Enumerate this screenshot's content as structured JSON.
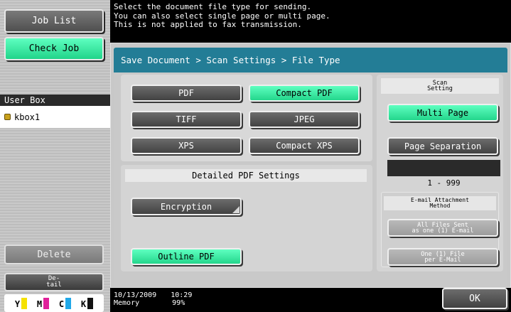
{
  "sidebar": {
    "job_list": "Job List",
    "check_job": "Check Job",
    "user_box_title": "User Box",
    "user_box_item": "kbox1",
    "delete": "Delete",
    "detail_line1": "De-",
    "detail_line2": "tail",
    "toner": [
      {
        "letter": "Y",
        "color": "#f5e100"
      },
      {
        "letter": "M",
        "color": "#e0209a"
      },
      {
        "letter": "C",
        "color": "#20a8e8"
      },
      {
        "letter": "K",
        "color": "#111111"
      }
    ]
  },
  "message": {
    "line1": "Select the document file type for sending.",
    "line2": "You can also select single page or multi page.",
    "line3": "This is not applied to fax transmission."
  },
  "breadcrumb": "Save Document > Scan Settings > File Type",
  "file_types": {
    "pdf": "PDF",
    "compact_pdf": "Compact PDF",
    "tiff": "TIFF",
    "jpeg": "JPEG",
    "xps": "XPS",
    "compact_xps": "Compact XPS",
    "selected": "Compact PDF"
  },
  "pdf_settings": {
    "title": "Detailed PDF Settings",
    "encryption": "Encryption",
    "outline_pdf": "Outline PDF"
  },
  "scan_setting": {
    "label_line1": "Scan",
    "label_line2": "Setting",
    "multi_page": "Multi Page",
    "page_separation": "Page Separation",
    "range": "1  -  999"
  },
  "email_method": {
    "label_line1": "E-mail Attachment",
    "label_line2": "Method",
    "all_files_line1": "All Files Sent",
    "all_files_line2": "as one (1) E-mail",
    "one_file_line1": "One (1) File",
    "one_file_line2": "per E-Mail"
  },
  "status": {
    "date": "10/13/2009",
    "time": "10:29",
    "memory_label": "Memory",
    "memory_value": "99%"
  },
  "ok": "OK",
  "colors": {
    "accent_green": "#33e09a",
    "breadcrumb_teal": "#237d96"
  }
}
